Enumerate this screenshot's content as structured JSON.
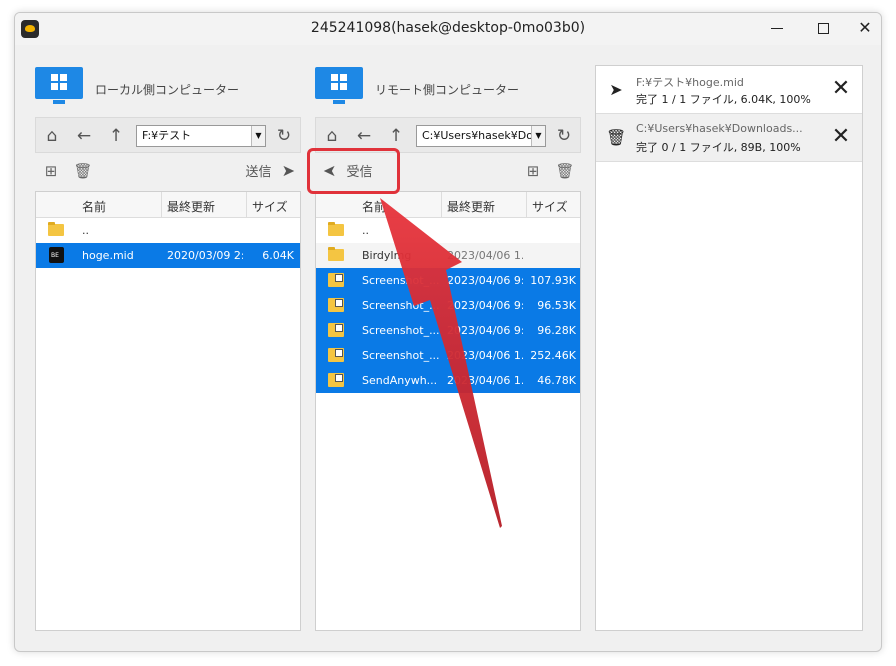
{
  "window": {
    "title": "245241098(hasek@desktop-0mo03b0)",
    "controls": {
      "minimize": "",
      "maximize": "",
      "close": "✕"
    }
  },
  "local": {
    "label": "ローカル側コンピューター",
    "path": "F:¥テスト",
    "send_label": "送信",
    "columns": [
      "名前",
      "最終更新",
      "サイズ"
    ],
    "rows": [
      {
        "name": "..",
        "date": "",
        "size": "",
        "icon": "folder-icon",
        "selected": false
      },
      {
        "name": "hoge.mid",
        "date": "2020/03/09 2:...",
        "size": "6.04K",
        "icon": "midi-file-icon",
        "selected": true
      }
    ]
  },
  "remote": {
    "label": "リモート側コンピューター",
    "path": "C:¥Users¥hasek¥Do",
    "recv_label": "受信",
    "columns": [
      "名前",
      "最終更新",
      "サイズ"
    ],
    "rows": [
      {
        "name": "..",
        "date": "",
        "size": "",
        "icon": "folder-icon",
        "selected": false
      },
      {
        "name": "BirdyImg",
        "date": "2023/04/06 1...",
        "size": "",
        "icon": "folder-icon",
        "selected": false
      },
      {
        "name": "Screenshot_...",
        "date": "2023/04/06 9:...",
        "size": "107.93K",
        "icon": "image-file-icon",
        "selected": true
      },
      {
        "name": "Screenshot_...",
        "date": "2023/04/06 9:...",
        "size": "96.53K",
        "icon": "image-file-icon",
        "selected": true
      },
      {
        "name": "Screenshot_...",
        "date": "2023/04/06 9:...",
        "size": "96.28K",
        "icon": "image-file-icon",
        "selected": true
      },
      {
        "name": "Screenshot_...",
        "date": "2023/04/06 1...",
        "size": "252.46K",
        "icon": "image-file-icon",
        "selected": true
      },
      {
        "name": "SendAnywh...",
        "date": "2023/04/06 1...",
        "size": "46.78K",
        "icon": "image-file-icon",
        "selected": true
      }
    ]
  },
  "queue": [
    {
      "icon": "send-icon",
      "path": "F:¥テスト¥hoge.mid",
      "status": "完了 1 / 1 ファイル, 6.04K, 100%"
    },
    {
      "icon": "trash-icon",
      "path": "C:¥Users¥hasek¥Downloads...",
      "status": "完了 0 / 1 ファイル, 89B, 100%"
    }
  ],
  "colors": {
    "selection": "#0a7ae6",
    "accent": "#1e88e5",
    "highlight": "#e0323a"
  }
}
